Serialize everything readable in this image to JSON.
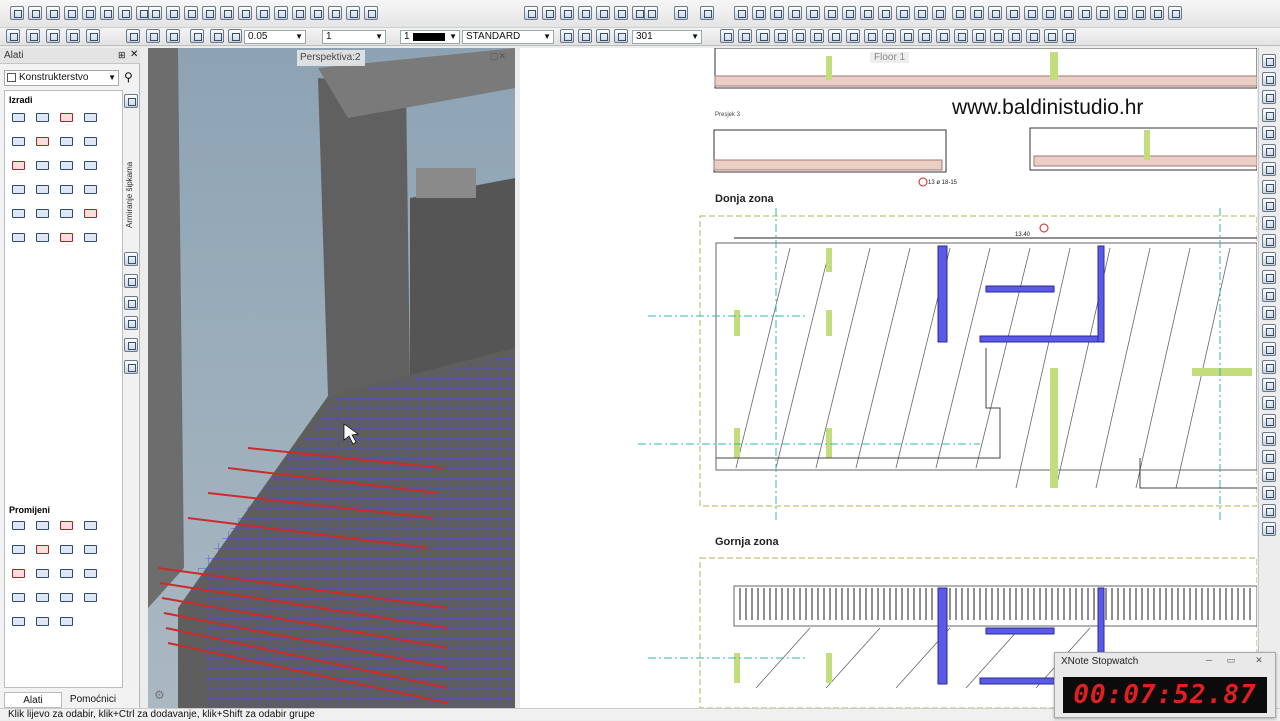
{
  "toolbar": {
    "line_width": "0.05",
    "line_type": "1",
    "pen": "1",
    "layer": "STANDARD",
    "scale": "301"
  },
  "tools_panel": {
    "title": "Alati",
    "module": "Konstrukterstvo",
    "group_create": "Izradi",
    "group_modify": "Promijeni",
    "vertical_tab": "Armiranje šipkama",
    "tab_tools": "Alati",
    "tab_aux": "Pomoćnici"
  },
  "viewport": {
    "label": "Perspektiva:2"
  },
  "drawing": {
    "watermark": "www.baldinistudio.hr",
    "tab_floor": "Floor 1",
    "section_label": "Presjek 3",
    "zone_bottom": "Donja zona",
    "zone_top": "Gornja zona",
    "dim_1": "13.40",
    "rebar_tag": "13 ø 18-15"
  },
  "stopwatch": {
    "title": "XNote Stopwatch",
    "time": "00:07:52.87"
  },
  "status": {
    "hint": "Klik lijevo za odabir, klik+Ctrl za dodavanje, klik+Shift za odabir grupe"
  },
  "colors": {
    "rebar_red": "#cc2b2b",
    "rebar_blue": "#3b3bd6",
    "cad_green": "#b4d46c",
    "cad_cyan": "#36b7b0",
    "stopwatch_digits": "#e02020"
  }
}
